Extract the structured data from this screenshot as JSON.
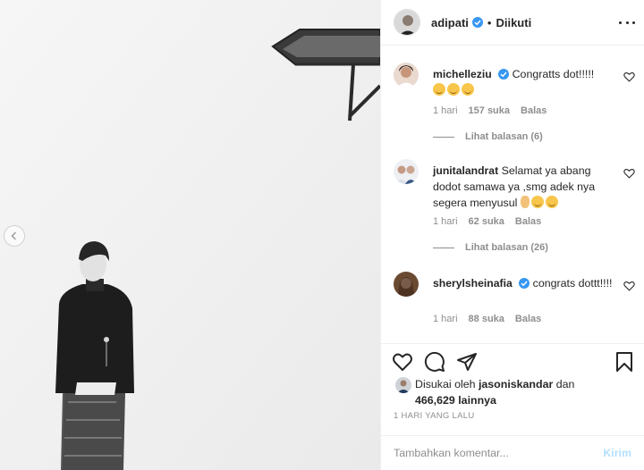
{
  "post": {
    "author": "adipati",
    "follow_state": "Diikuti",
    "separator": "•",
    "icons": {
      "more": "more-horizontal-icon",
      "verified": "verified-badge-icon"
    }
  },
  "comments": [
    {
      "username": "michelleziu",
      "verified": true,
      "text": "Congratts dot!!!!!",
      "emoji": [
        "hugging-face",
        "hugging-face",
        "hugging-face"
      ],
      "age": "1 hari",
      "likes": "157 suka",
      "reply_label": "Balas",
      "view_replies": "Lihat balasan (6)"
    },
    {
      "username": "junitalandrat",
      "verified": false,
      "text": "Selamat ya abang dodot samawa ya ,smg adek nya segera menyusul",
      "emoji": [
        "ok-hand",
        "grinning-squint",
        "grinning"
      ],
      "age": "1 hari",
      "likes": "62 suka",
      "reply_label": "Balas",
      "view_replies": "Lihat balasan (26)"
    },
    {
      "username": "sherylsheinafia",
      "verified": true,
      "text": "congrats dottt!!!!",
      "age": "1 hari",
      "likes": "88 suka",
      "reply_label": "Balas"
    }
  ],
  "liked_by": {
    "prefix": "Disukai oleh",
    "user": "jasoniskandar",
    "conjunction": "dan",
    "others": "466,629 lainnya"
  },
  "timestamp": "1 HARI YANG LALU",
  "composer": {
    "placeholder": "Tambahkan komentar...",
    "send_label": "Kirim"
  },
  "colors": {
    "verified": "#3897f0",
    "send_disabled": "#b2dffc",
    "secondary_text": "#8e8e8e",
    "primary_text": "#262626",
    "border": "#efefef"
  }
}
